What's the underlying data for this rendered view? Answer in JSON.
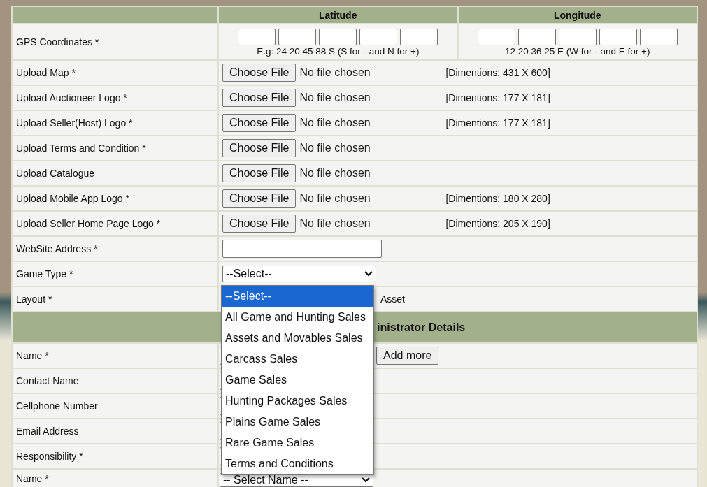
{
  "columns": [
    "Latitude",
    "Longitude"
  ],
  "gps": {
    "label": "GPS Coordinates *",
    "latitude_hint": "E.g: 24 20 45 88 S (S for - and N for +)",
    "longitude_hint": "12 20 36 25 E (W for - and E for +)"
  },
  "rows": [
    {
      "kind": "file",
      "label": "Upload Map *",
      "button": "Choose File",
      "status": "No file chosen",
      "note": "[Dimentions: 431 X 600]"
    },
    {
      "kind": "file",
      "label": "Upload Auctioneer Logo *",
      "button": "Choose File",
      "status": "No file chosen",
      "note": "[Dimentions: 177 X 181]"
    },
    {
      "kind": "file",
      "label": "Upload Seller(Host) Logo *",
      "button": "Choose File",
      "status": "No file chosen",
      "note": "[Dimentions: 177 X 181]"
    },
    {
      "kind": "file",
      "label": "Upload Terms and Condition *",
      "button": "Choose File",
      "status": "No file chosen"
    },
    {
      "kind": "file",
      "label": "Upload Catalogue",
      "button": "Choose File",
      "status": "No file chosen"
    },
    {
      "kind": "file",
      "label": "Upload Mobile App Logo *",
      "button": "Choose File",
      "status": "No file chosen",
      "note": "[Dimentions: 180 X 280]"
    },
    {
      "kind": "file",
      "label": "Upload Seller Home Page Logo *",
      "button": "Choose File",
      "status": "No file chosen",
      "note": "[Dimentions: 205 X 190]"
    },
    {
      "kind": "text",
      "label": "WebSite Address *"
    },
    {
      "kind": "select",
      "label": "Game Type *",
      "value": "--Select--"
    },
    {
      "kind": "radio",
      "label": "Layout *",
      "option": "Asset"
    }
  ],
  "section": {
    "title": "inistrator Details"
  },
  "admin_rows": [
    {
      "kind": "name",
      "label": "Name *",
      "button": "Add more"
    },
    {
      "kind": "text",
      "label": "Contact Name"
    },
    {
      "kind": "text",
      "label": "Cellphone Number"
    },
    {
      "kind": "text",
      "label": "Email Address"
    },
    {
      "kind": "text",
      "label": "Responsibility *"
    },
    {
      "kind": "select",
      "label": "Name *",
      "value": "-- Select Name --"
    }
  ],
  "dropdown": {
    "options": [
      {
        "label": "--Select--",
        "selected": true
      },
      {
        "label": "All Game and Hunting Sales",
        "selected": false
      },
      {
        "label": "Assets and Movables Sales",
        "selected": false
      },
      {
        "label": "Carcass Sales",
        "selected": false
      },
      {
        "label": "Game Sales",
        "selected": false
      },
      {
        "label": "Hunting Packages Sales",
        "selected": false
      },
      {
        "label": "Plains Game Sales",
        "selected": false
      },
      {
        "label": "Rare Game Sales",
        "selected": false
      },
      {
        "label": "Terms and Conditions",
        "selected": false
      }
    ]
  }
}
